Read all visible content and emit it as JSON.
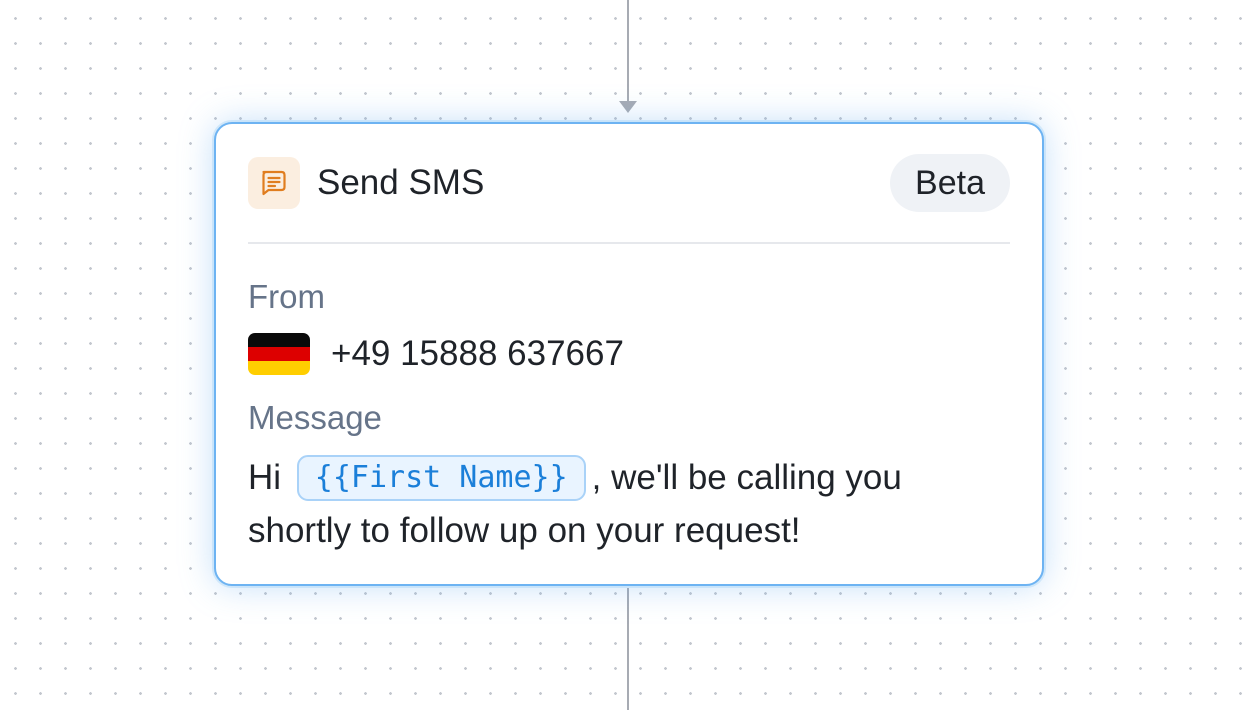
{
  "node": {
    "title": "Send SMS",
    "icon": "message-icon",
    "badge": "Beta",
    "accent_color": "#6db3f2",
    "from": {
      "label": "From",
      "country_flag": "germany-flag-icon",
      "phone": "+49 15888 637667"
    },
    "message": {
      "label": "Message",
      "before_token": "Hi",
      "token": "{{First Name}}",
      "after_token": ", we'll be calling you shortly to follow up on your request!"
    }
  }
}
